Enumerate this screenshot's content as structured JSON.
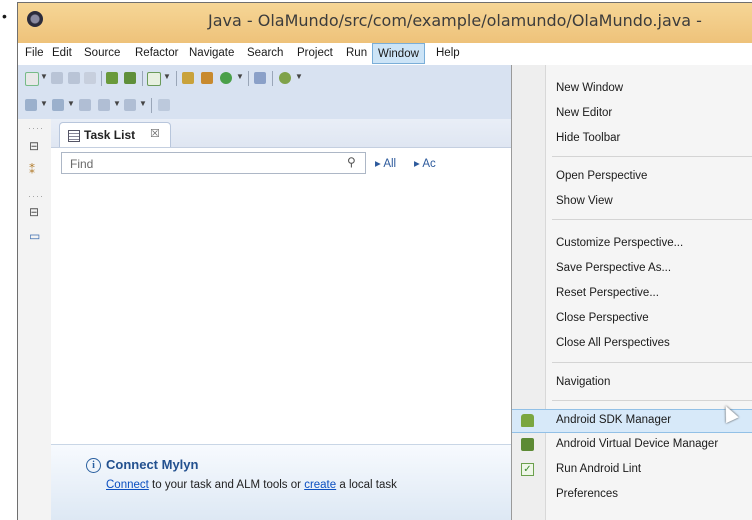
{
  "window": {
    "title": "Java - OlaMundo/src/com/example/olamundo/OlaMundo.java -"
  },
  "menubar": [
    {
      "label": "File"
    },
    {
      "label": "Edit"
    },
    {
      "label": "Source"
    },
    {
      "label": "Refactor"
    },
    {
      "label": "Navigate"
    },
    {
      "label": "Search"
    },
    {
      "label": "Project"
    },
    {
      "label": "Run"
    },
    {
      "label": "Window",
      "active": true
    },
    {
      "label": "Help"
    }
  ],
  "task_list": {
    "tab_label": "Task List",
    "tab_close": "☒",
    "find_placeholder": "Find",
    "filter_all": "▸ All",
    "filter_ac": "▸ Ac"
  },
  "mylyn": {
    "info": "i",
    "title": "Connect Mylyn",
    "connect_link": "Connect",
    "text_middle": " to your task and ALM tools or ",
    "create_link": "create",
    "text_end": " a local task"
  },
  "window_menu": {
    "items": [
      {
        "label": "New Window"
      },
      {
        "label": "New Editor"
      },
      {
        "label": "Hide Toolbar"
      },
      {
        "label": "Open Perspective"
      },
      {
        "label": "Show View"
      },
      {
        "label": "Customize Perspective..."
      },
      {
        "label": "Save Perspective As..."
      },
      {
        "label": "Reset Perspective..."
      },
      {
        "label": "Close Perspective"
      },
      {
        "label": "Close All Perspectives"
      },
      {
        "label": "Navigation"
      },
      {
        "label": "Android SDK Manager",
        "icon": "android-sdk-icon",
        "highlighted": true
      },
      {
        "label": "Android Virtual Device Manager",
        "icon": "avd-icon"
      },
      {
        "label": "Run Android Lint",
        "icon": "lint-check-icon"
      },
      {
        "label": "Preferences"
      }
    ]
  },
  "colors": {
    "title_bar": "#eec27a",
    "toolbar": "#d8e2f1",
    "menu_highlight": "#d7e9f9",
    "link": "#0b4fc0"
  }
}
